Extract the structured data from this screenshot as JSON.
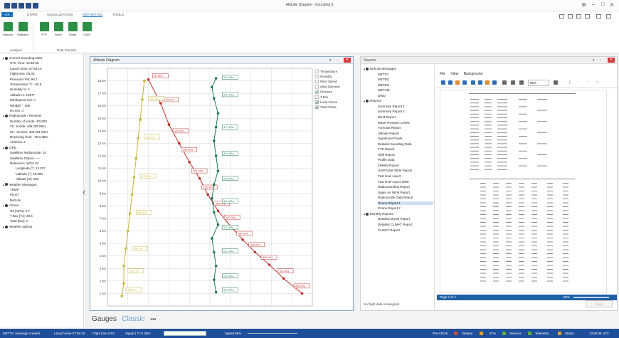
{
  "window": {
    "title": "Altitude Diagram - Sounding 9"
  },
  "tabs": [
    {
      "label": "AS",
      "kind": "file"
    },
    {
      "label": "START"
    },
    {
      "label": "VISUALIZATION"
    },
    {
      "label": "REPORTING",
      "active": true
    },
    {
      "label": "TOOLS"
    }
  ],
  "ribbon": {
    "buttons": [
      {
        "label": "Reports",
        "icon": "reports-icon"
      },
      {
        "label": "Statistics",
        "icon": "statistics-icon"
      },
      {
        "label": "FTP",
        "icon": "ftp-icon"
      },
      {
        "label": "WMO",
        "icon": "wmo-icon"
      },
      {
        "label": "Email",
        "icon": "email-icon"
      },
      {
        "label": "GDM",
        "icon": "gdm-icon"
      }
    ],
    "groups": [
      "Analysis",
      "Data Transfer"
    ]
  },
  "tree": {
    "items": [
      {
        "label": "Current Sounding Data",
        "level": 0
      },
      {
        "label": "UTC Time: 13:59:35",
        "level": 1
      },
      {
        "label": "Launch time: 07:56:10",
        "level": 1
      },
      {
        "label": "Flight time: 06:03",
        "level": 1
      },
      {
        "label": "Pressure hPa: 98.7",
        "level": 1
      },
      {
        "label": "Temperature °C: -50.6",
        "level": 1
      },
      {
        "label": "Humidity %: 4",
        "level": 1
      },
      {
        "label": "Altitude m: 16077",
        "level": 1
      },
      {
        "label": "Windspeed m/s: 7",
        "level": 1
      },
      {
        "label": "Winddir °: 250",
        "level": 1
      },
      {
        "label": "Rs m/s: 4",
        "level": 1
      },
      {
        "label": "Radiosonde / Receiver",
        "level": 0
      },
      {
        "label": "Number of sonde: 401093",
        "level": 1
      },
      {
        "label": "Ch. Sonde: 405.200 MHz",
        "level": 1
      },
      {
        "label": "Ch. receiver: 405.201 MHz",
        "level": 1
      },
      {
        "label": "Receiving level: -79.0 dBm",
        "level": 1
      },
      {
        "label": "Antenna: 2",
        "level": 1
      },
      {
        "label": "GPS",
        "level": 0
      },
      {
        "label": "Satellites Radiosonde: 10",
        "level": 1
      },
      {
        "label": "Satellites Station: ----",
        "level": 1
      },
      {
        "label": "Reference: WGS 84",
        "level": 1
      },
      {
        "label": "Longitude [°]: 13.207",
        "level": 2
      },
      {
        "label": "Latitude [°]: 48.690",
        "level": 2
      },
      {
        "label": "Altitude [m]: 322",
        "level": 2
      },
      {
        "label": "Weather Messages",
        "level": 0
      },
      {
        "label": "TEMP",
        "level": 1
      },
      {
        "label": "PILOT",
        "level": 1
      },
      {
        "label": "Bufr.dis",
        "level": 1
      },
      {
        "label": "Ozone",
        "level": 0
      },
      {
        "label": "O3 [mPa]: 5.7",
        "level": 1
      },
      {
        "label": "T Box [°C]: 28.6",
        "level": 1
      },
      {
        "label": "Total [DU]: 0",
        "level": 1
      },
      {
        "label": "Weather advisor",
        "level": 0
      }
    ]
  },
  "diagram": {
    "title": "Altitude Diagram",
    "legend": [
      {
        "label": "Temperature",
        "checked": false
      },
      {
        "label": "Humidity",
        "checked": false
      },
      {
        "label": "Wind Speed",
        "checked": false
      },
      {
        "label": "Wind Direction",
        "checked": false
      },
      {
        "label": "Pressure",
        "checked": true
      },
      {
        "label": "T Box",
        "checked": false
      },
      {
        "label": "Local Ozone",
        "checked": true
      },
      {
        "label": "Total Ozone",
        "checked": true
      }
    ],
    "colors": {
      "pressure": "#c0302c",
      "local_ozone": "#1f7a4f",
      "total_ozone": "#c8b43c"
    }
  },
  "chart_data": {
    "type": "line",
    "xlabel": "",
    "ylabel": "",
    "ylim": [
      0,
      19
    ],
    "y_ticks": [
      "1 km",
      "2 km",
      "3 km",
      "4 km",
      "5 km",
      "6 km",
      "7 km",
      "8 km",
      "9 km",
      "10 km",
      "11 km",
      "12 km",
      "13 km",
      "14 km",
      "15 km",
      "16 km",
      "17 km",
      "18 km"
    ],
    "series": [
      {
        "name": "Pressure",
        "color": "#c0302c",
        "points": [
          [
            0.2,
            18.1
          ],
          [
            0.26,
            16.2
          ],
          [
            0.3,
            14.5
          ],
          [
            0.35,
            13.0
          ],
          [
            0.4,
            11.5
          ],
          [
            0.45,
            10.2
          ],
          [
            0.49,
            8.9
          ],
          [
            0.54,
            7.6
          ],
          [
            0.6,
            6.4
          ],
          [
            0.66,
            5.3
          ],
          [
            0.72,
            4.3
          ],
          [
            0.79,
            3.3
          ],
          [
            0.86,
            2.2
          ],
          [
            0.95,
            1.0
          ]
        ],
        "labels": [
          [
            0.22,
            18.4,
            "80 hPa"
          ],
          [
            0.27,
            16.5,
            "100 hPa"
          ],
          [
            0.32,
            14.0,
            "120 hPa"
          ],
          [
            0.36,
            12.5,
            "150 hPa"
          ],
          [
            0.41,
            10.8,
            "200 hPa"
          ],
          [
            0.46,
            9.5,
            "250 hPa"
          ],
          [
            0.52,
            8.2,
            "300 hPa"
          ],
          [
            0.57,
            7.1,
            "350 hPa"
          ],
          [
            0.63,
            5.8,
            "450 hPa"
          ],
          [
            0.69,
            4.9,
            "500 hPa"
          ],
          [
            0.75,
            3.9,
            "600 hPa"
          ],
          [
            0.83,
            2.8,
            "700 hPa"
          ],
          [
            0.91,
            1.6,
            "850 hPa"
          ]
        ]
      },
      {
        "name": "Local Ozone",
        "color": "#1f7a4f",
        "points": [
          [
            0.53,
            18.2
          ],
          [
            0.51,
            17.5
          ],
          [
            0.52,
            16.6
          ],
          [
            0.54,
            15.4
          ],
          [
            0.53,
            14.3
          ],
          [
            0.52,
            13.2
          ],
          [
            0.53,
            12.0
          ],
          [
            0.54,
            10.8
          ],
          [
            0.52,
            9.7
          ],
          [
            0.51,
            8.6
          ],
          [
            0.52,
            7.5
          ],
          [
            0.54,
            6.5
          ],
          [
            0.51,
            5.4
          ],
          [
            0.52,
            4.3
          ],
          [
            0.53,
            3.2
          ],
          [
            0.52,
            2.1
          ],
          [
            0.53,
            1.1
          ]
        ],
        "labels": [
          [
            0.56,
            18.3,
            "5.7 mPa"
          ],
          [
            0.56,
            16.9,
            "5.4 mPa"
          ],
          [
            0.56,
            14.3,
            "4.7 mPa"
          ],
          [
            0.56,
            12.2,
            "3.9 mPa"
          ],
          [
            0.56,
            10.2,
            "2.8 mPa"
          ],
          [
            0.56,
            8.4,
            "1.9 mPa"
          ],
          [
            0.56,
            6.3,
            "1.7 mPa"
          ],
          [
            0.56,
            4.4,
            "2.1 mPa"
          ],
          [
            0.56,
            2.4,
            "2.8 mPa"
          ],
          [
            0.56,
            1.3,
            "3.1 mPa"
          ]
        ]
      },
      {
        "name": "Total Ozone",
        "color": "#c8b43c",
        "points": [
          [
            0.18,
            18.0
          ],
          [
            0.17,
            16.5
          ],
          [
            0.16,
            14.9
          ],
          [
            0.15,
            13.4
          ],
          [
            0.14,
            11.8
          ],
          [
            0.13,
            10.3
          ],
          [
            0.12,
            8.9
          ],
          [
            0.11,
            7.4
          ],
          [
            0.1,
            6.0
          ],
          [
            0.09,
            4.6
          ],
          [
            0.08,
            3.2
          ],
          [
            0.08,
            1.8
          ],
          [
            0.07,
            0.8
          ]
        ],
        "labels": [
          [
            0.2,
            16.6,
            "262 DU"
          ],
          [
            0.18,
            13.5,
            "268 DU"
          ],
          [
            0.16,
            10.4,
            "275 DU"
          ],
          [
            0.14,
            7.5,
            "283 DU"
          ],
          [
            0.12,
            4.6,
            "290 DU"
          ],
          [
            0.1,
            2.8,
            "297 DU"
          ],
          [
            0.09,
            1.3,
            "303 DU"
          ]
        ]
      }
    ]
  },
  "reports": {
    "title": "Reports",
    "tree": [
      {
        "label": "Bufr.dis Messages",
        "level": 0
      },
      {
        "label": "METTA",
        "level": 1
      },
      {
        "label": "METEO",
        "level": 1
      },
      {
        "label": "METEO",
        "level": 1
      },
      {
        "label": "METCM",
        "level": 1
      },
      {
        "label": "DWD",
        "level": 1
      },
      {
        "label": "Reports",
        "level": 0
      },
      {
        "label": "Summary Report 1",
        "level": 1
      },
      {
        "label": "Summary Report 2",
        "level": 1
      },
      {
        "label": "Wind Report",
        "level": 1
      },
      {
        "label": "Mean Pressure Levels",
        "level": 1
      },
      {
        "label": "Forecast Report",
        "level": 1
      },
      {
        "label": "Altitude Report",
        "level": 1
      },
      {
        "label": "Significant Points",
        "level": 1
      },
      {
        "label": "Detailed Sounding Data",
        "level": 1
      },
      {
        "label": "FTE Report",
        "level": 1
      },
      {
        "label": "Shift Report",
        "level": 1
      },
      {
        "label": "Profile Data",
        "level": 1
      },
      {
        "label": "ZWWM Report",
        "level": 1
      },
      {
        "label": "UAIR Data Table Report",
        "level": 1
      },
      {
        "label": "Fast level report",
        "level": 1
      },
      {
        "label": "Fast level report 2006",
        "level": 1
      },
      {
        "label": "Radiosounding Report",
        "level": 1
      },
      {
        "label": "Upper Air Wind Report",
        "level": 1
      },
      {
        "label": "Radiosonde Data Report",
        "level": 1
      },
      {
        "label": "Ozone Report 1",
        "level": 1,
        "selected": true
      },
      {
        "label": "Ozone Report 2",
        "level": 1
      },
      {
        "label": "Monthly Reports",
        "level": 0
      },
      {
        "label": "Detailed Month Report",
        "level": 1
      },
      {
        "label": "Detailed CLIMAT Report",
        "level": 1
      },
      {
        "label": "CLIMAT Report",
        "level": 1
      }
    ],
    "viewer_menu": [
      "File",
      "View",
      "Background"
    ],
    "zoom": "85%",
    "page_label": "Page 1 of 1",
    "status_zoom": "85%",
    "no_flight": "No flight data is assigned",
    "close_label": "Close"
  },
  "bottom_tabs": {
    "gauges": "Gauges",
    "classic": "Classic",
    "more": "•••"
  },
  "status": {
    "message": "METTA: message created",
    "launch": "Launch time 07:56:10",
    "flight": "Flight time 6:03",
    "signal": "Signal | 77.0 dBm",
    "speed": "Speed 98%",
    "pre_check": "Pre-Check",
    "battery": "Battery",
    "battery_value": "67%",
    "sensors": "Sensors",
    "telemetry": "Telemetry",
    "status_label": "Status",
    "clock": "13:59:35 UTC"
  }
}
